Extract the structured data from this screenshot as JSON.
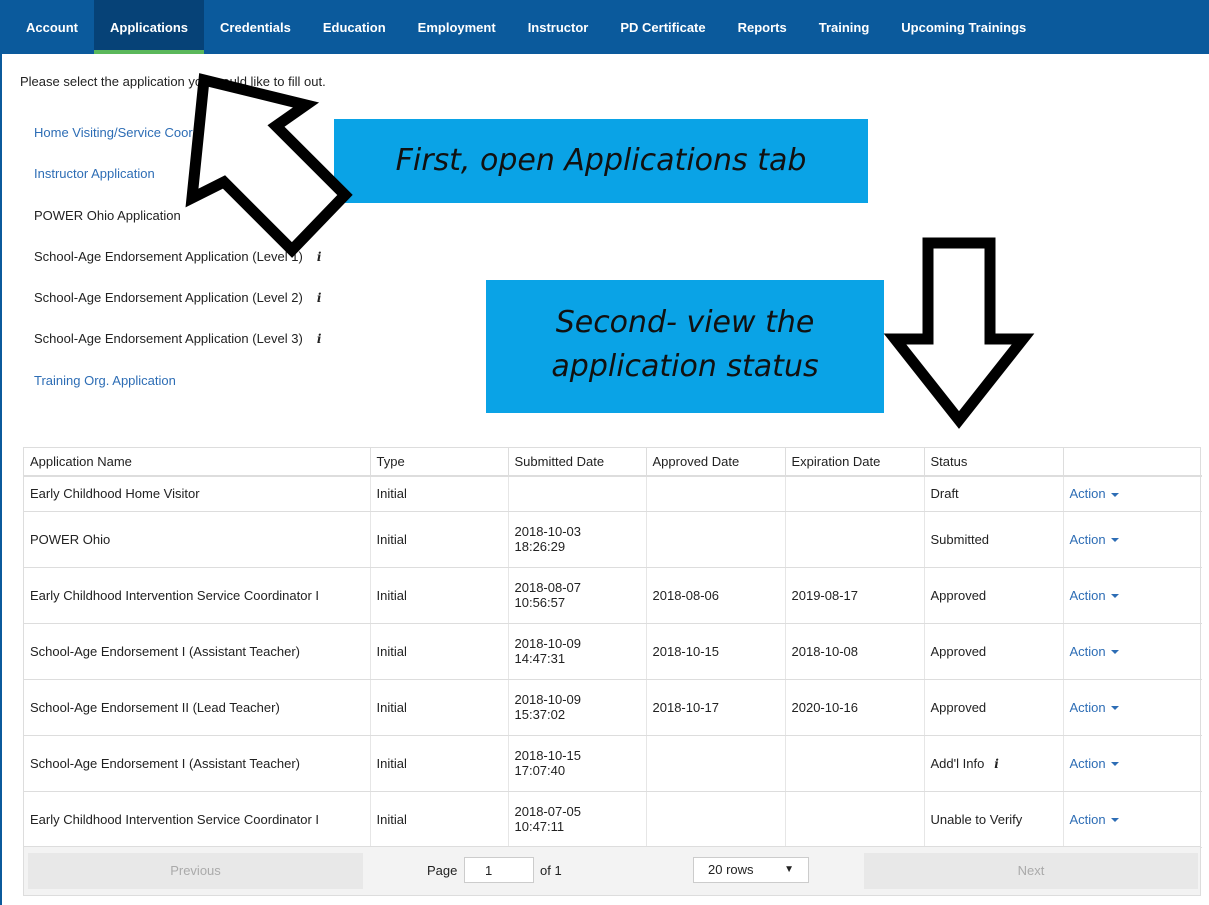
{
  "nav": {
    "tabs": [
      {
        "label": "Account"
      },
      {
        "label": "Applications"
      },
      {
        "label": "Credentials"
      },
      {
        "label": "Education"
      },
      {
        "label": "Employment"
      },
      {
        "label": "Instructor"
      },
      {
        "label": "PD Certificate"
      },
      {
        "label": "Reports"
      },
      {
        "label": "Training"
      },
      {
        "label": "Upcoming Trainings"
      }
    ],
    "active": "Applications",
    "bg_color": "#0b5a9c",
    "active_indicator_color": "#5bb85b"
  },
  "intro_text": "Please select the application you would like to fill out.",
  "applications": [
    {
      "label": "Home Visiting/Service Coordination",
      "link": true
    },
    {
      "label": "Instructor Application",
      "link": true
    },
    {
      "label": "POWER Ohio Application",
      "link": false
    },
    {
      "label": "School-Age Endorsement Application (Level 1)",
      "link": false,
      "info_icon": "i"
    },
    {
      "label": "School-Age Endorsement Application (Level 2)",
      "link": false,
      "info_icon": "i"
    },
    {
      "label": "School-Age Endorsement Application (Level 3)",
      "link": false,
      "info_icon": "i"
    },
    {
      "label": "Training Org. Application",
      "link": true
    }
  ],
  "callouts": {
    "first": "First, open Applications tab",
    "second_line1": "Second- view the",
    "second_line2": "application status",
    "color": "#0aa3e6"
  },
  "table": {
    "headers": [
      "Application Name",
      "Type",
      "Submitted Date",
      "Approved Date",
      "Expiration Date",
      "Status",
      ""
    ],
    "rows": [
      {
        "name": "Early Childhood Home Visitor",
        "type": "Initial",
        "submitted_date": "",
        "submitted_time": "",
        "approved": "",
        "expiration": "",
        "status": "Draft",
        "action": "Action"
      },
      {
        "name": "POWER Ohio",
        "type": "Initial",
        "submitted_date": "2018-10-03",
        "submitted_time": "18:26:29",
        "approved": "",
        "expiration": "",
        "status": "Submitted",
        "action": "Action"
      },
      {
        "name": "Early Childhood Intervention Service Coordinator I",
        "type": "Initial",
        "submitted_date": "2018-08-07",
        "submitted_time": "10:56:57",
        "approved": "2018-08-06",
        "expiration": "2019-08-17",
        "status": "Approved",
        "action": "Action"
      },
      {
        "name": "School-Age Endorsement I (Assistant Teacher)",
        "type": "Initial",
        "submitted_date": "2018-10-09",
        "submitted_time": "14:47:31",
        "approved": "2018-10-15",
        "expiration": "2018-10-08",
        "status": "Approved",
        "action": "Action"
      },
      {
        "name": "School-Age Endorsement II (Lead Teacher)",
        "type": "Initial",
        "submitted_date": "2018-10-09",
        "submitted_time": "15:37:02",
        "approved": "2018-10-17",
        "expiration": "2020-10-16",
        "status": "Approved",
        "action": "Action"
      },
      {
        "name": "School-Age Endorsement I (Assistant Teacher)",
        "type": "Initial",
        "submitted_date": "2018-10-15",
        "submitted_time": "17:07:40",
        "approved": "",
        "expiration": "",
        "status": "Add'l Info",
        "status_info_icon": "i",
        "action": "Action"
      },
      {
        "name": "Early Childhood Intervention Service Coordinator I",
        "type": "Initial",
        "submitted_date": "2018-07-05",
        "submitted_time": "10:47:11",
        "approved": "",
        "expiration": "",
        "status": "Unable to Verify",
        "action": "Action"
      }
    ]
  },
  "pager": {
    "previous": "Previous",
    "next": "Next",
    "page_label": "Page",
    "page_value": "1",
    "of_label": "of 1",
    "rows_option": "20 rows",
    "rows_caret": "▼"
  }
}
